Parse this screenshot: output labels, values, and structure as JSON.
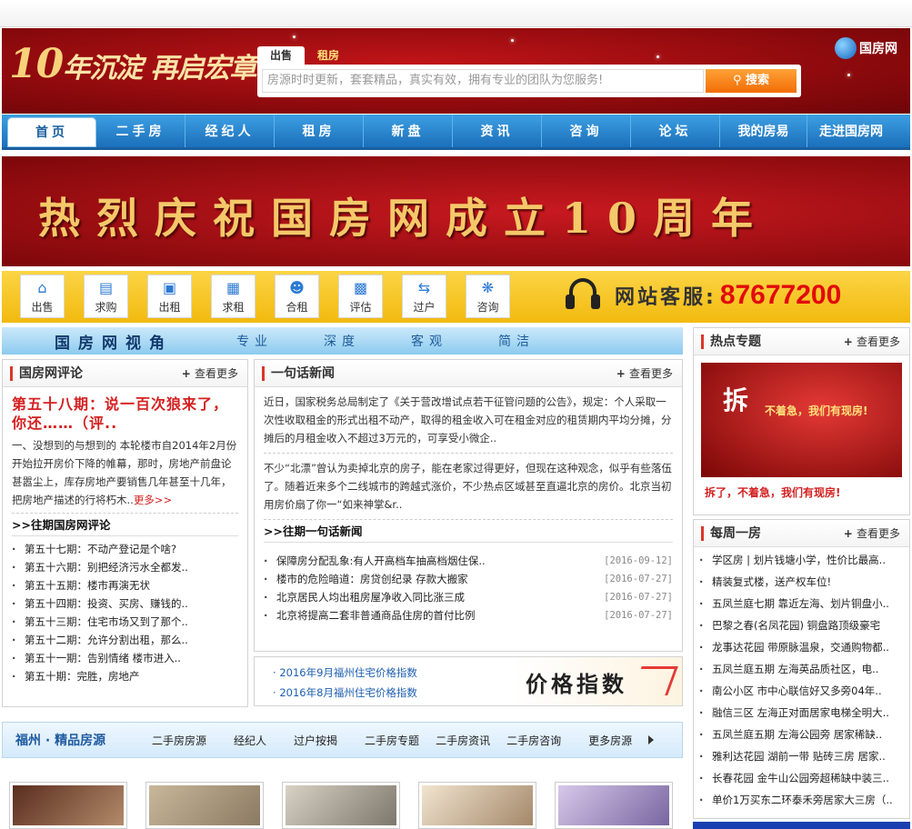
{
  "header": {
    "slogan_years": "10",
    "slogan_text": "年沉淀 再启宏章",
    "search_tabs": [
      "出售",
      "租房"
    ],
    "search_placeholder": "房源时时更新，套套精品，真实有效，拥有专业的团队为您服务!",
    "search_button": "搜索",
    "logo_text": "国房网"
  },
  "nav": {
    "items": [
      "首页",
      "二手房",
      "经纪人",
      "租房",
      "新盘",
      "资讯",
      "咨询",
      "论坛",
      "我的房易",
      "走进国房网"
    ]
  },
  "banner": {
    "text": "热烈庆祝国房网成立10周年"
  },
  "quickbar": {
    "items": [
      {
        "label": "出售",
        "icon": "house-icon"
      },
      {
        "label": "求购",
        "icon": "buy-icon"
      },
      {
        "label": "出租",
        "icon": "rent-out-icon"
      },
      {
        "label": "求租",
        "icon": "rent-icon"
      },
      {
        "label": "合租",
        "icon": "people-icon"
      },
      {
        "label": "评估",
        "icon": "calculator-icon"
      },
      {
        "label": "过户",
        "icon": "transfer-icon"
      },
      {
        "label": "咨询",
        "icon": "consult-icon"
      }
    ],
    "service_label": "网站客服:",
    "service_number": "87677200"
  },
  "perspective": {
    "title": "国房网视角",
    "tags": [
      "专业",
      "深度",
      "客观",
      "简洁"
    ]
  },
  "commentary": {
    "title": "国房网评论",
    "more": "查看更多",
    "feature_title": "第五十八期：说一百次狼来了，你还……（评..",
    "feature_body": "一、没想到的与想到的 本轮楼市自2014年2月份开始拉开房价下降的帷幕，那时，房地产前盘论甚嚣尘上，库存房地产要销售几年甚至十几年，把房地产描述的行将朽木..",
    "feature_more": "更多>>",
    "past_title": ">>往期国房网评论",
    "past_items": [
      "第五十七期：不动产登记是个啥?",
      "第五十六期：别把经济污水全都发..",
      "第五十五期：楼市再演无状",
      "第五十四期：投资、买房、赚钱的..",
      "第五十三期：住宅市场又到了那个..",
      "第五十二期：允许分割出租，那么..",
      "第五十一期：告别情绪 楼市进入..",
      "第五十期：完胜，房地产"
    ]
  },
  "news": {
    "title": "一句话新闻",
    "more": "查看更多",
    "para1": "近日，国家税务总局制定了《关于营改增试点若干征管问题的公告》，规定：个人采取一次性收取租金的形式出租不动产，取得的租金收入可在租金对应的租赁期内平均分摊，分摊后的月租金收入不超过3万元的，可享受小微企..",
    "para2": "不少“北漂”曾认为卖掉北京的房子，能在老家过得更好，但现在这种观念，似乎有些落伍了。随着近来多个二线城市的跨越式涨价，不少热点区域甚至直逼北京的房价。北京当初用房价扇了你一“如来神掌&r..",
    "past_title": ">>往期一句话新闻",
    "past_items": [
      {
        "text": "保障房分配乱象:有人开高档车抽高档烟住保..",
        "date": "[2016-09-12]"
      },
      {
        "text": "楼市的危险暗道：房贷创纪录 存款大搬家",
        "date": "[2016-07-27]"
      },
      {
        "text": "北京居民人均出租房屋净收入同比涨三成",
        "date": "[2016-07-27]"
      },
      {
        "text": "北京将提高二套非普通商品住房的首付比例",
        "date": "[2016-07-27]"
      }
    ]
  },
  "price_index": {
    "links": [
      "2016年9月福州住宅价格指数",
      "2016年8月福州住宅价格指数"
    ],
    "label": "价格指数"
  },
  "fuzhou": {
    "title": "福州 · 精品房源",
    "links": [
      "二手房房源",
      "经纪人",
      "过户按揭",
      "二手房专题",
      "二手房资讯",
      "二手房咨询",
      "更多房源"
    ]
  },
  "hot_topics": {
    "title": "热点专题",
    "more": "查看更多",
    "img_text1": "拆",
    "img_text2": "不着急，我们有现房!",
    "caption": "拆了，不着急，我们有现房!"
  },
  "weekly": {
    "title": "每周一房",
    "more": "查看更多",
    "items": [
      "学区房 | 划片钱塘小学，性价比最高..",
      "精装复式楼，送产权车位!",
      "五凤兰庭七期 靠近左海、划片铜盘小..",
      "巴黎之春(名凤花园) 铜盘路顶级豪宅",
      "龙事达花园 带原脉温泉，交通购物都..",
      "五凤兰庭五期 左海英品质社区，电..",
      "南公小区 市中心联信好又多旁04年..",
      "融信三区 左海正对面居家电梯全明大..",
      "五凤兰庭五期 左海公园旁 居家稀缺..",
      "雅利达花园 湖前一带 贴砖三房 居家..",
      "长春花园 金牛山公园旁超稀缺中装三..",
      "单价1万买东二环泰禾旁居家大三房（.."
    ]
  },
  "colors": {
    "accent_red": "#d42020",
    "nav_blue": "#1b6fba",
    "quickbar_yellow": "#f2ba0f"
  }
}
